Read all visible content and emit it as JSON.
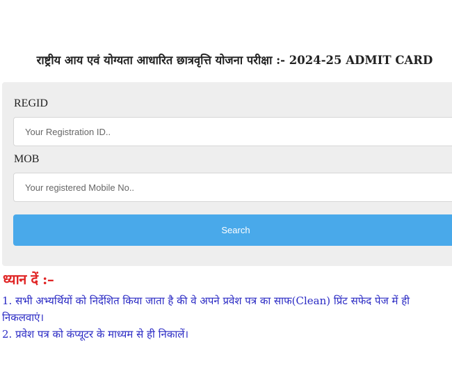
{
  "header": {
    "title": "राष्ट्रीय आय एवं योग्यता आधारित छात्रवृत्ति योजना परीक्षा :- 2024-25 ADMIT CARD"
  },
  "form": {
    "regid_label": "REGID",
    "regid_placeholder": "Your Registration ID..",
    "regid_value": "",
    "mob_label": "MOB",
    "mob_placeholder": "Your registered Mobile No..",
    "mob_value": "",
    "search_label": "Search"
  },
  "notice": {
    "heading": "ध्यान दें :–",
    "items": [
      "1. सभी अभ्यर्थियों को निर्देशित किया जाता है की वे अपने प्रवेश पत्र का साफ(Clean) प्रिंट सफेद पेज में ही निकलवाएं।",
      "2. प्रवेश पत्र को कंप्यूटर के माध्यम से ही निकालें।"
    ]
  },
  "colors": {
    "button": "#49a9ea",
    "panel": "#eeeeee",
    "notice_heading": "#e02424",
    "notice_text": "#2a2ac4"
  }
}
